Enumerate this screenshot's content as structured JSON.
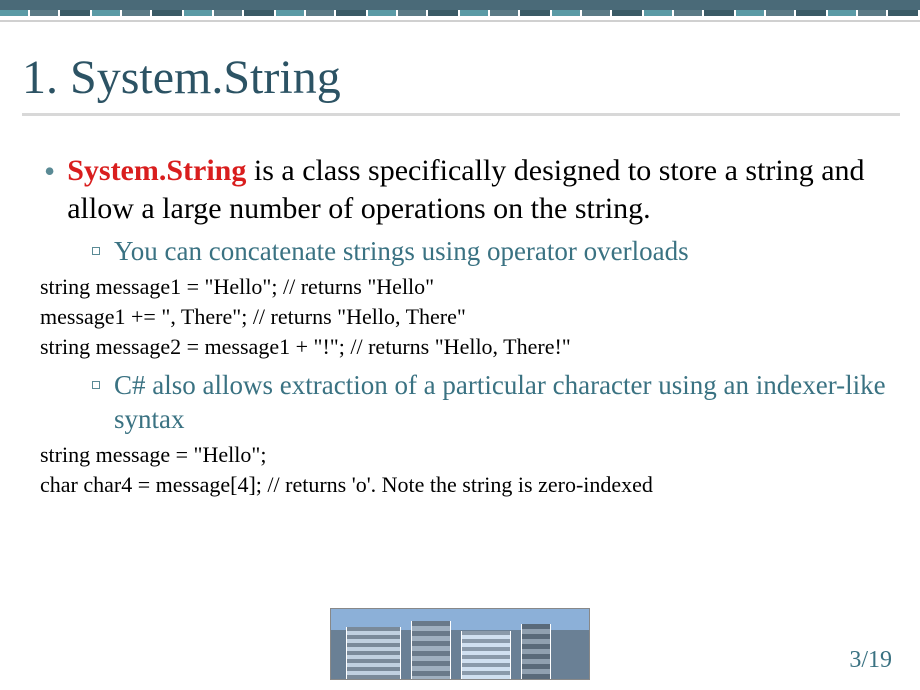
{
  "title": "1. System.String",
  "main": {
    "highlight": "System.String",
    "text": " is a class specifically designed to store a string and allow a large number of operations on the string."
  },
  "sub1": "You can concatenate strings using operator overloads",
  "code1": {
    "line1": "string message1 = \"Hello\"; // returns \"Hello\"",
    "line2": "message1 += \", There\"; // returns \"Hello, There\"",
    "line3": "string message2 = message1 + \"!\"; // returns \"Hello, There!\""
  },
  "sub2": "C# also allows extraction of a particular character using an indexer-like syntax",
  "code2": {
    "line1": "string message = \"Hello\";",
    "line2": "char char4 = message[4]; // returns 'o'. Note the string is zero-indexed"
  },
  "pageNumber": "3/19"
}
